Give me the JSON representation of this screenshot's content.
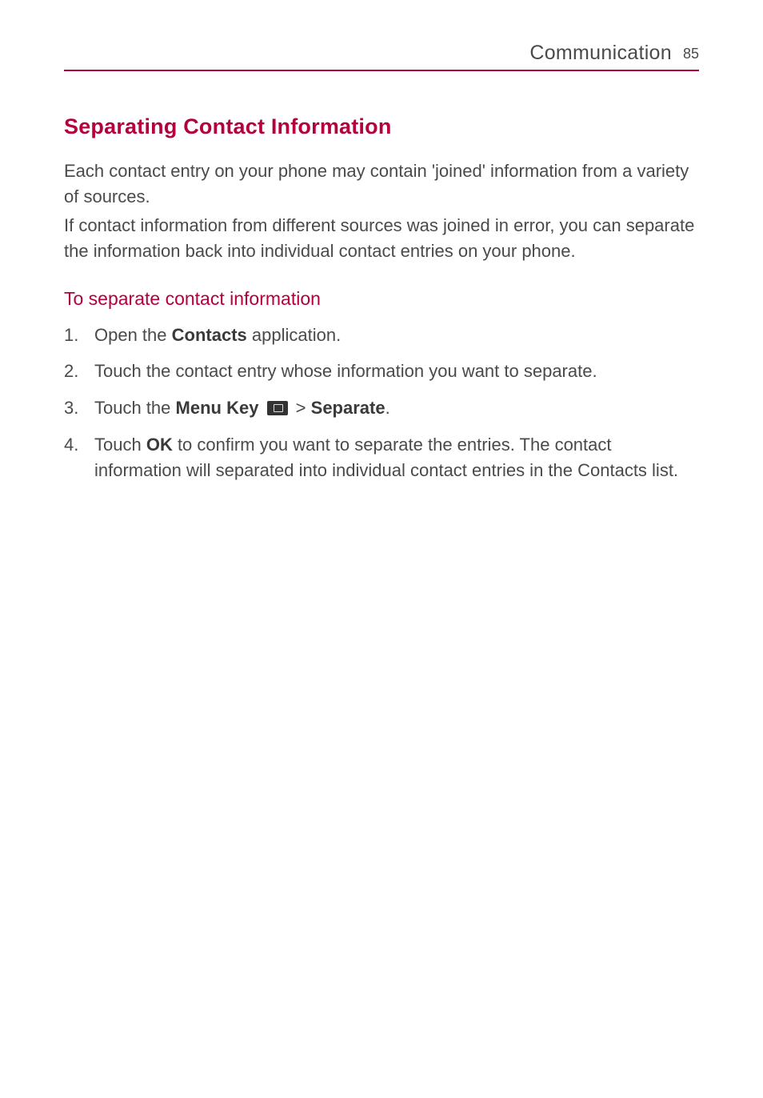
{
  "header": {
    "title": "Communication",
    "page_number": "85"
  },
  "section": {
    "heading": "Separating Contact Information",
    "para1": "Each contact entry on your phone may contain 'joined' information from a variety of sources.",
    "para2": "If contact information from different sources was joined in error, you can separate the information back into individual contact entries on your phone."
  },
  "subsection": {
    "heading": "To separate contact information",
    "items": [
      {
        "num": "1.",
        "pre": " Open the ",
        "bold1": "Contacts",
        "post": " application."
      },
      {
        "num": "2.",
        "pre": " Touch the contact entry whose information you want to separate.",
        "bold1": "",
        "post": ""
      },
      {
        "num": "3.",
        "pre": "Touch the ",
        "bold1": "Menu Key",
        "mid": " > ",
        "bold2": "Separate",
        "post": "."
      },
      {
        "num": "4.",
        "pre": " Touch ",
        "bold1": "OK",
        "post": " to confirm you want to separate the entries. The contact information will separated into individual contact entries in the Contacts list."
      }
    ]
  }
}
